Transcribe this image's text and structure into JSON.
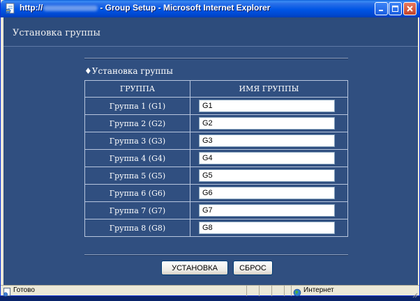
{
  "window": {
    "title_prefix": "http://",
    "title_suffix": "- Group Setup - Microsoft Internet Explorer"
  },
  "page": {
    "header_title": "Установка группы",
    "section_title": "♦Установка группы"
  },
  "table": {
    "headers": [
      "ГРУППА",
      "ИМЯ ГРУППЫ"
    ],
    "rows": [
      {
        "label": "Группа 1 (G1)",
        "value": "G1"
      },
      {
        "label": "Группа 2 (G2)",
        "value": "G2"
      },
      {
        "label": "Группа 3 (G3)",
        "value": "G3"
      },
      {
        "label": "Группа 4 (G4)",
        "value": "G4"
      },
      {
        "label": "Группа 5 (G5)",
        "value": "G5"
      },
      {
        "label": "Группа 6 (G6)",
        "value": "G6"
      },
      {
        "label": "Группа 7 (G7)",
        "value": "G7"
      },
      {
        "label": "Группа 8 (G8)",
        "value": "G8"
      }
    ]
  },
  "buttons": {
    "set": "УСТАНОВКА",
    "reset": "СБРОС"
  },
  "statusbar": {
    "status": "Готово",
    "zone": "Интернет"
  },
  "icons": {
    "title": "ie-page-icon",
    "status_page": "page-icon",
    "zone": "globe-icon"
  }
}
